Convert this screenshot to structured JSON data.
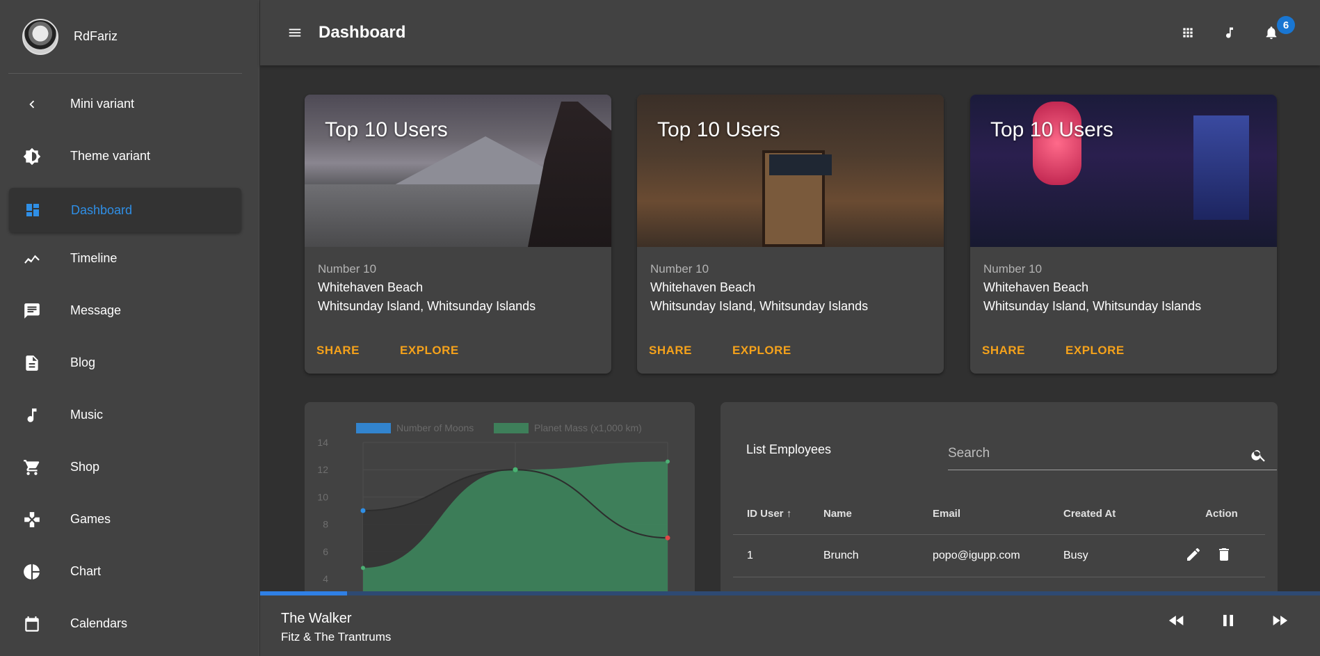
{
  "user": {
    "name": "RdFariz"
  },
  "sidebar": {
    "top_items": [
      {
        "label": "Mini variant",
        "icon": "chevron-left-icon"
      },
      {
        "label": "Theme variant",
        "icon": "brightness-icon"
      }
    ],
    "items": [
      {
        "label": "Dashboard",
        "icon": "dashboard-icon",
        "active": true
      },
      {
        "label": "Timeline",
        "icon": "timeline-icon"
      },
      {
        "label": "Message",
        "icon": "message-icon"
      },
      {
        "label": "Blog",
        "icon": "document-icon"
      },
      {
        "label": "Music",
        "icon": "music-note-icon"
      },
      {
        "label": "Shop",
        "icon": "cart-icon"
      },
      {
        "label": "Games",
        "icon": "gamepad-icon"
      },
      {
        "label": "Chart",
        "icon": "pie-chart-icon"
      },
      {
        "label": "Calendars",
        "icon": "calendar-icon"
      }
    ]
  },
  "header": {
    "title": "Dashboard",
    "notification_count": "6"
  },
  "cards": [
    {
      "title": "Top 10 Users",
      "subtitle": "Number 10",
      "line1": "Whitehaven Beach",
      "line2": "Whitsunday Island, Whitsunday Islands",
      "share": "SHARE",
      "explore": "EXPLORE"
    },
    {
      "title": "Top 10 Users",
      "subtitle": "Number 10",
      "line1": "Whitehaven Beach",
      "line2": "Whitsunday Island, Whitsunday Islands",
      "share": "SHARE",
      "explore": "EXPLORE"
    },
    {
      "title": "Top 10 Users",
      "subtitle": "Number 10",
      "line1": "Whitehaven Beach",
      "line2": "Whitsunday Island, Whitsunday Islands",
      "share": "SHARE",
      "explore": "EXPLORE"
    }
  ],
  "chart_data": {
    "type": "line",
    "x": [
      0,
      1,
      2
    ],
    "series": [
      {
        "name": "Number of Moons",
        "values": [
          9,
          12,
          7
        ],
        "color": "#2f8fe6"
      },
      {
        "name": "Planet Mass (x1,000 km)",
        "values": [
          4.8,
          12,
          12.6
        ],
        "color": "#3d8a5e"
      }
    ],
    "yticks": [
      "14",
      "12",
      "10",
      "8",
      "6",
      "4"
    ],
    "ylim": [
      4,
      14
    ],
    "grid": true,
    "legend": "top"
  },
  "employees": {
    "title": "List Employees",
    "search_placeholder": "Search",
    "columns": [
      "ID User",
      "Name",
      "Email",
      "Created At",
      "Action"
    ],
    "rows": [
      {
        "id": "1",
        "name": "Brunch",
        "email": "popo@igupp.com",
        "created": "Busy"
      }
    ]
  },
  "player": {
    "title": "The Walker",
    "artist": "Fitz & The Trantrums",
    "progress": 0.082
  },
  "colors": {
    "accent": "#2f8fe6",
    "action": "#f5a21b",
    "surface": "#424242",
    "background": "#303030"
  }
}
